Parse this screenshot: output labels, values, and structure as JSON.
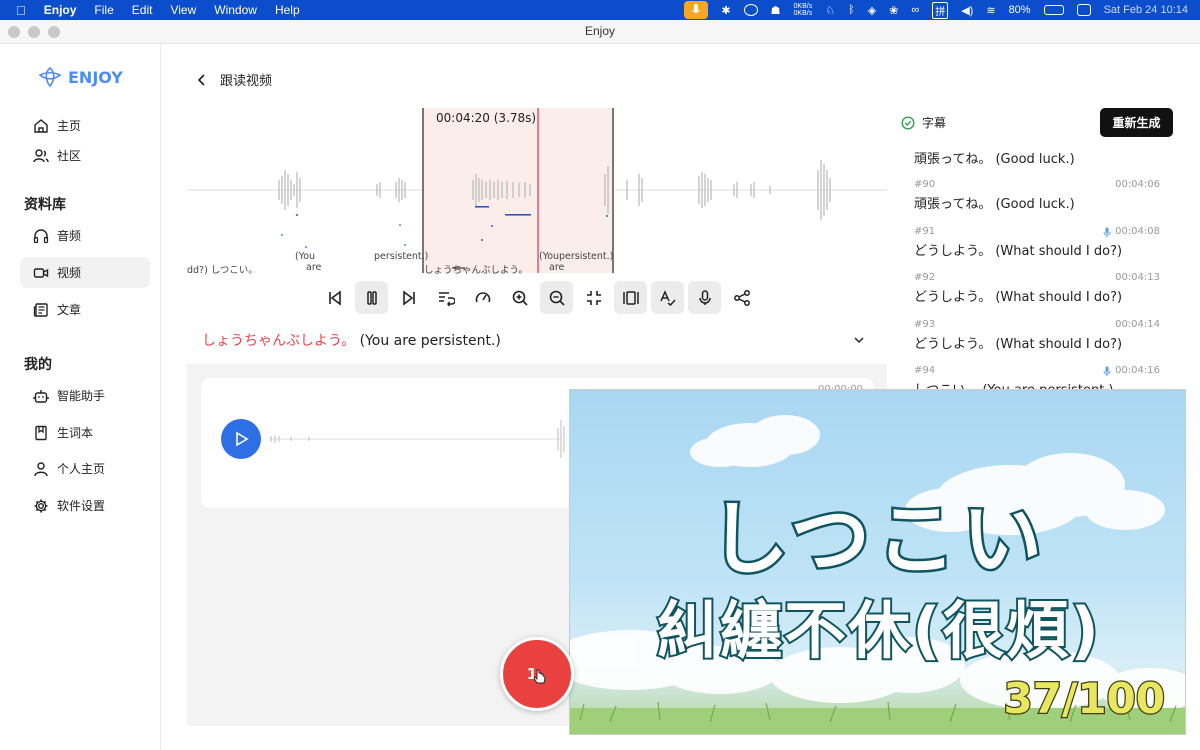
{
  "menubar": {
    "app": "Enjoy",
    "items": [
      "File",
      "Edit",
      "View",
      "Window",
      "Help"
    ],
    "net_up": "0KB/s",
    "net_down": "0KB/s",
    "input_method": "拼",
    "battery": "80%",
    "datetime": "Sat Feb 24  10:14"
  },
  "window": {
    "title": "Enjoy"
  },
  "sidebar": {
    "logo": "ENJOY",
    "home": "主页",
    "community": "社区",
    "library_heading": "资料库",
    "audio": "音频",
    "video": "视频",
    "article": "文章",
    "mine_heading": "我的",
    "assistant": "智能助手",
    "vocabulary": "生词本",
    "profile": "个人主页",
    "settings": "软件设置"
  },
  "page": {
    "back_label": "跟读视频"
  },
  "waveform": {
    "region_time": "00:04:20 (3.78s)",
    "labels": [
      "dd?) しつこい。",
      "(You",
      "are",
      "persistent.)",
      "しょうちゃんぶしよう。",
      "(You",
      "are",
      "persistent.)"
    ]
  },
  "caption": {
    "japanese": "しょうちゃんぶしよう。",
    "english": "(You are persistent.)"
  },
  "recording": {
    "time": "00:00:00"
  },
  "subtitles": {
    "heading": "字幕",
    "regenerate": "重新生成",
    "first_partial": "頑張ってね。 (Good luck.)",
    "items": [
      {
        "num": "#90",
        "time": "00:04:06",
        "text": "頑張ってね。 (Good luck.)",
        "mic": false
      },
      {
        "num": "#91",
        "time": "00:04:08",
        "text": "どうしよう。 (What should I do?)",
        "mic": true
      },
      {
        "num": "#92",
        "time": "00:04:13",
        "text": "どうしよう。 (What should I do?)",
        "mic": false
      },
      {
        "num": "#93",
        "time": "00:04:14",
        "text": "どうしよう。 (What should I do?)",
        "mic": false
      },
      {
        "num": "#94",
        "time": "00:04:16",
        "text": "しつこい。 (You are persistent.)",
        "mic": true
      }
    ]
  },
  "video": {
    "title_jp": "しつこい",
    "title_cn": "糾纏不休(很煩)",
    "counter": "37/100"
  },
  "record_button": {
    "label": "1"
  },
  "colors": {
    "accent": "#2f6fe5",
    "caption_jp": "#e5484d",
    "record": "#e94040",
    "menubar": "#0c4dcc"
  }
}
